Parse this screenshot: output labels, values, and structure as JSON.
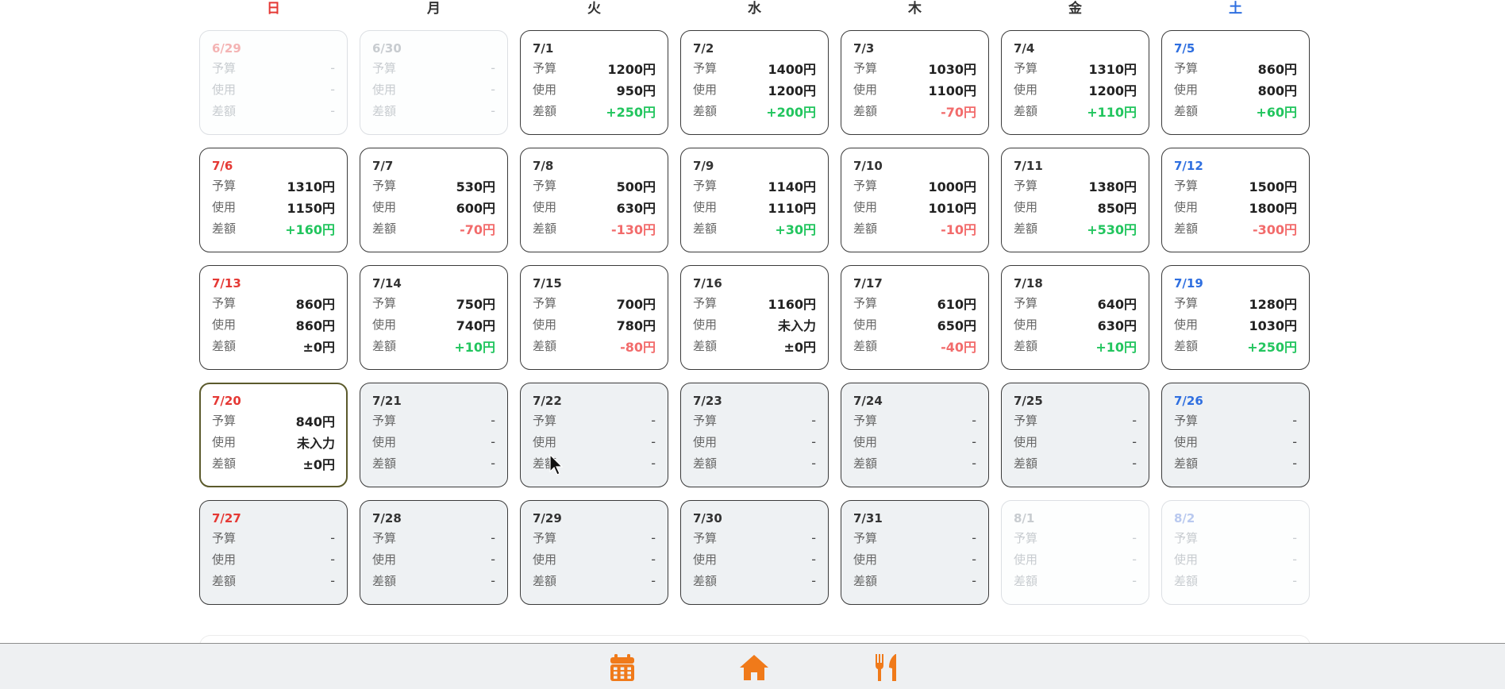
{
  "weekdays": [
    "日",
    "月",
    "火",
    "水",
    "木",
    "金",
    "土"
  ],
  "row_labels": {
    "budget": "予算",
    "used": "使用",
    "diff": "差額"
  },
  "weeks": [
    [
      {
        "date": "6/29",
        "budget": "-",
        "used": "-",
        "diff": "-",
        "state": "outside"
      },
      {
        "date": "6/30",
        "budget": "-",
        "used": "-",
        "diff": "-",
        "state": "outside"
      },
      {
        "date": "7/1",
        "budget": "1200円",
        "used": "950円",
        "diff": "+250円",
        "state": "past"
      },
      {
        "date": "7/2",
        "budget": "1400円",
        "used": "1200円",
        "diff": "+200円",
        "state": "past"
      },
      {
        "date": "7/3",
        "budget": "1030円",
        "used": "1100円",
        "diff": "-70円",
        "state": "past"
      },
      {
        "date": "7/4",
        "budget": "1310円",
        "used": "1200円",
        "diff": "+110円",
        "state": "past"
      },
      {
        "date": "7/5",
        "budget": "860円",
        "used": "800円",
        "diff": "+60円",
        "state": "past"
      }
    ],
    [
      {
        "date": "7/6",
        "budget": "1310円",
        "used": "1150円",
        "diff": "+160円",
        "state": "past"
      },
      {
        "date": "7/7",
        "budget": "530円",
        "used": "600円",
        "diff": "-70円",
        "state": "past"
      },
      {
        "date": "7/8",
        "budget": "500円",
        "used": "630円",
        "diff": "-130円",
        "state": "past"
      },
      {
        "date": "7/9",
        "budget": "1140円",
        "used": "1110円",
        "diff": "+30円",
        "state": "past"
      },
      {
        "date": "7/10",
        "budget": "1000円",
        "used": "1010円",
        "diff": "-10円",
        "state": "past"
      },
      {
        "date": "7/11",
        "budget": "1380円",
        "used": "850円",
        "diff": "+530円",
        "state": "past"
      },
      {
        "date": "7/12",
        "budget": "1500円",
        "used": "1800円",
        "diff": "-300円",
        "state": "past"
      }
    ],
    [
      {
        "date": "7/13",
        "budget": "860円",
        "used": "860円",
        "diff": "±0円",
        "state": "past"
      },
      {
        "date": "7/14",
        "budget": "750円",
        "used": "740円",
        "diff": "+10円",
        "state": "past"
      },
      {
        "date": "7/15",
        "budget": "700円",
        "used": "780円",
        "diff": "-80円",
        "state": "past"
      },
      {
        "date": "7/16",
        "budget": "1160円",
        "used": "未入力",
        "diff": "±0円",
        "state": "past"
      },
      {
        "date": "7/17",
        "budget": "610円",
        "used": "650円",
        "diff": "-40円",
        "state": "past"
      },
      {
        "date": "7/18",
        "budget": "640円",
        "used": "630円",
        "diff": "+10円",
        "state": "past"
      },
      {
        "date": "7/19",
        "budget": "1280円",
        "used": "1030円",
        "diff": "+250円",
        "state": "past"
      }
    ],
    [
      {
        "date": "7/20",
        "budget": "840円",
        "used": "未入力",
        "diff": "±0円",
        "state": "today"
      },
      {
        "date": "7/21",
        "budget": "-",
        "used": "-",
        "diff": "-",
        "state": "future"
      },
      {
        "date": "7/22",
        "budget": "-",
        "used": "-",
        "diff": "-",
        "state": "future"
      },
      {
        "date": "7/23",
        "budget": "-",
        "used": "-",
        "diff": "-",
        "state": "future"
      },
      {
        "date": "7/24",
        "budget": "-",
        "used": "-",
        "diff": "-",
        "state": "future"
      },
      {
        "date": "7/25",
        "budget": "-",
        "used": "-",
        "diff": "-",
        "state": "future"
      },
      {
        "date": "7/26",
        "budget": "-",
        "used": "-",
        "diff": "-",
        "state": "future"
      }
    ],
    [
      {
        "date": "7/27",
        "budget": "-",
        "used": "-",
        "diff": "-",
        "state": "future"
      },
      {
        "date": "7/28",
        "budget": "-",
        "used": "-",
        "diff": "-",
        "state": "future"
      },
      {
        "date": "7/29",
        "budget": "-",
        "used": "-",
        "diff": "-",
        "state": "future"
      },
      {
        "date": "7/30",
        "budget": "-",
        "used": "-",
        "diff": "-",
        "state": "future"
      },
      {
        "date": "7/31",
        "budget": "-",
        "used": "-",
        "diff": "-",
        "state": "future"
      },
      {
        "date": "8/1",
        "budget": "-",
        "used": "-",
        "diff": "-",
        "state": "outside"
      },
      {
        "date": "8/2",
        "budget": "-",
        "used": "-",
        "diff": "-",
        "state": "outside"
      }
    ]
  ],
  "bottom_nav": [
    {
      "name": "calendar",
      "icon": "calendar-icon"
    },
    {
      "name": "home",
      "icon": "home-icon"
    },
    {
      "name": "meals",
      "icon": "fork-knife-icon"
    }
  ],
  "colors": {
    "sunday": "#e53935",
    "saturday": "#2f6fe0",
    "positive": "#22c55e",
    "negative": "#f26b6b",
    "accent": "#f07a1a",
    "today_border": "#5b5a2c"
  }
}
